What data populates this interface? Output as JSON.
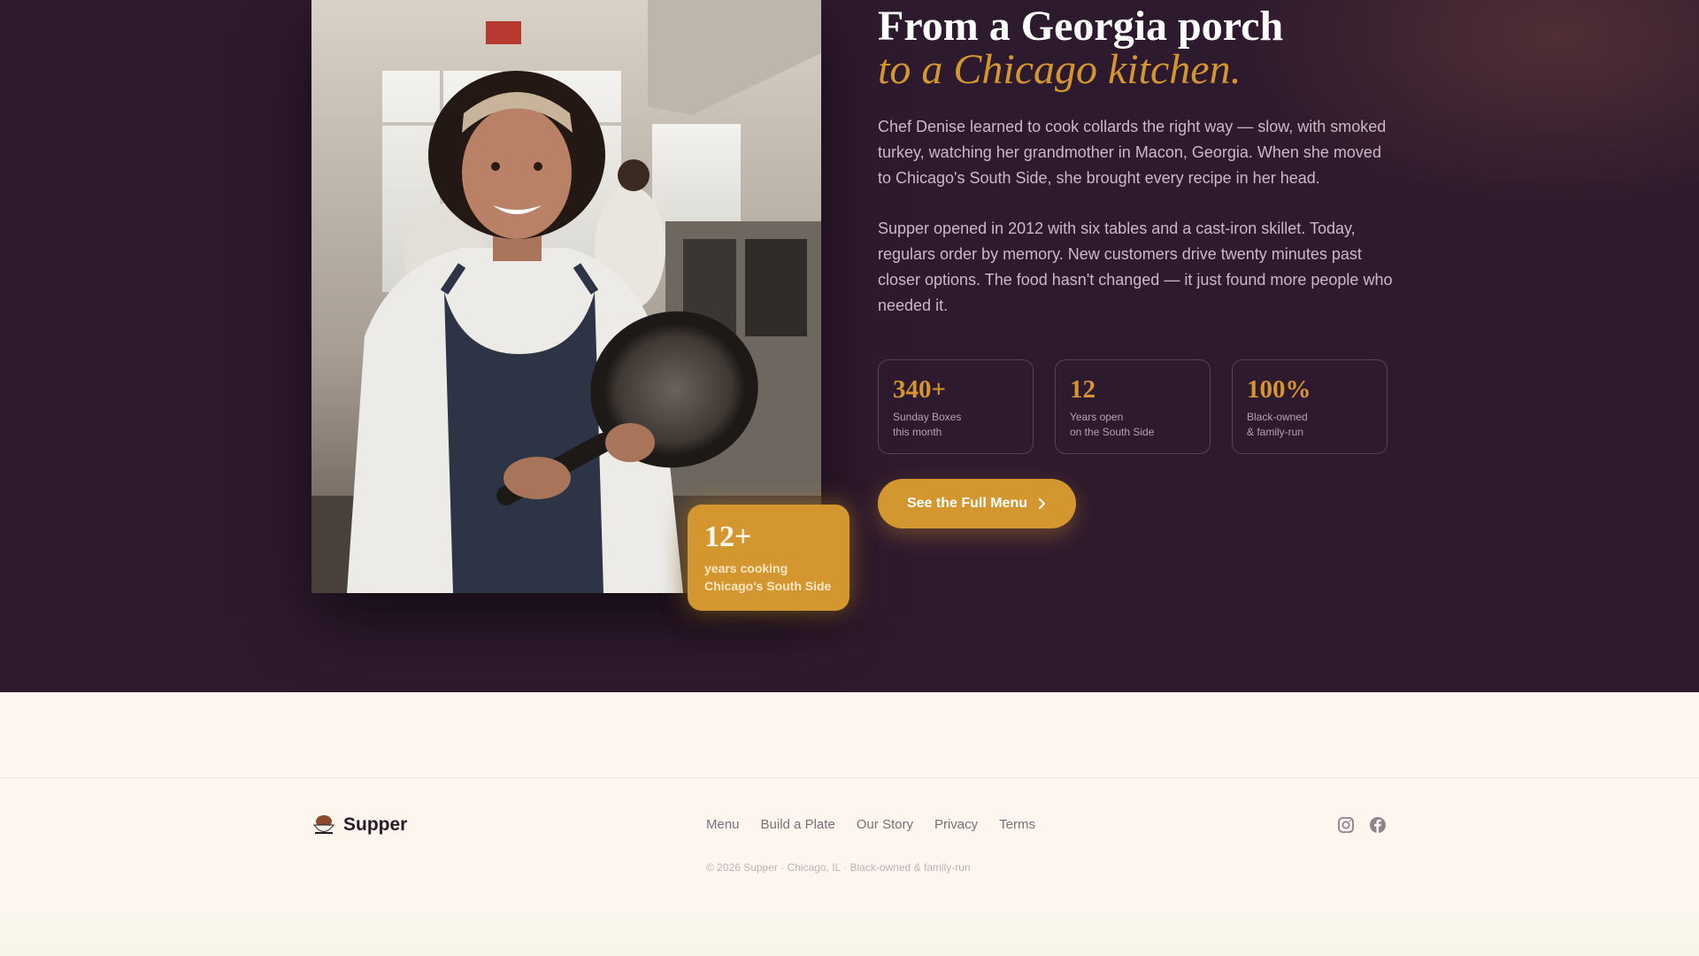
{
  "story": {
    "headline_line1": "From a Georgia porch",
    "headline_line2": "to a Chicago kitchen.",
    "paragraph1": "Chef Denise learned to cook collards the right way — slow, with smoked turkey, watching her grandmother in Macon, Georgia. When she moved to Chicago's South Side, she brought every recipe in her head.",
    "paragraph2": "Supper opened in 2012 with six tables and a cast-iron skillet. Today, regulars order by memory. New customers drive twenty minutes past closer options. The food hasn't changed — it just found more people who needed it.",
    "badge": {
      "value": "12+",
      "line1": "years cooking",
      "line2": "Chicago's South Side"
    },
    "stats": [
      {
        "value": "340+",
        "line1": "Sunday Boxes",
        "line2": "this month"
      },
      {
        "value": "12",
        "line1": "Years open",
        "line2": "on the South Side"
      },
      {
        "value": "100%",
        "line1": "Black-owned",
        "line2": "& family-run"
      }
    ],
    "cta_label": "See the Full Menu",
    "photo_icon": "chef-portrait-image"
  },
  "footer": {
    "brand_name": "Supper",
    "brand_icon": "bowl-logo-icon",
    "nav": [
      "Menu",
      "Build a Plate",
      "Our Story",
      "Privacy",
      "Terms"
    ],
    "copyright": "© 2026 Supper · Chicago, IL · Black-owned & family-run",
    "social_icons": [
      "instagram-icon",
      "facebook-icon"
    ]
  },
  "colors": {
    "background_dark": "#2e1a2e",
    "accent": "#d4962f",
    "footer_background": "#fdf6ee"
  }
}
